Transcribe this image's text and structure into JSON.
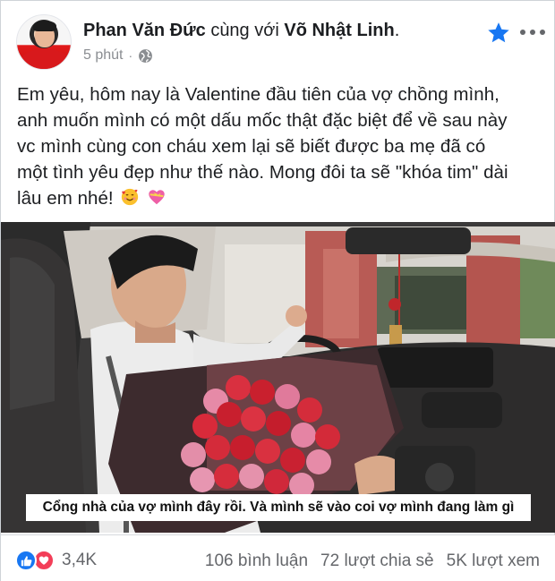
{
  "post": {
    "author_name": "Phan Văn Đức",
    "with_text": "cùng với",
    "tagged_name": "Võ Nhật Linh",
    "tagged_suffix": ".",
    "time": "5 phút",
    "separator": "·",
    "privacy_icon": "globe-icon",
    "text_line1": "Em yêu, hôm nay là Valentine đầu tiên của vợ chồng mình,",
    "text_line2": "anh muốn mình có một dấu mốc thật đặc biệt để về sau này",
    "text_line3": "vc mình cùng con cháu xem lại sẽ biết được ba mẹ đã có",
    "text_line4": "một tình yêu đẹp như thế nào. Mong đôi ta sẽ \"khóa tim\" dài",
    "text_line5": "lâu em nhé!",
    "emojis": [
      "smiling-face-with-hearts-icon",
      "heart-with-ribbon-icon"
    ]
  },
  "video": {
    "subtitle": "Cổng nhà của vợ mình đây rồi. Và mình sẽ vào coi vợ mình đang làm gì"
  },
  "footer": {
    "reaction_icons": [
      "like-icon",
      "love-icon"
    ],
    "reaction_count": "3,4K",
    "comments": "106 bình luận",
    "shares": "72 lượt chia sẻ",
    "views": "5K lượt xem"
  },
  "colors": {
    "accent": "#1877f2",
    "love": "#f33e58",
    "secondary_text": "#65676b"
  }
}
